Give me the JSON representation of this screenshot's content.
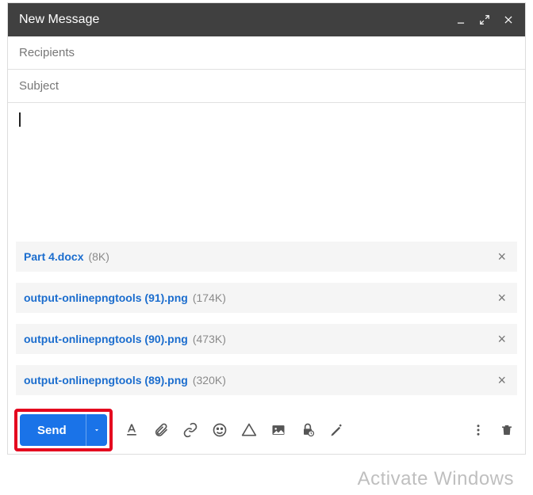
{
  "title": "New Message",
  "fields": {
    "recipients_placeholder": "Recipients",
    "subject_placeholder": "Subject"
  },
  "body_text": "",
  "attachments": [
    {
      "name": "Part 4.docx",
      "size": "(8K)"
    },
    {
      "name": "output-onlinepngtools (91).png",
      "size": "(174K)"
    },
    {
      "name": "output-onlinepngtools (90).png",
      "size": "(473K)"
    },
    {
      "name": "output-onlinepngtools (89).png",
      "size": "(320K)"
    }
  ],
  "footer": {
    "send_label": "Send"
  },
  "watermark": "Activate Windows"
}
